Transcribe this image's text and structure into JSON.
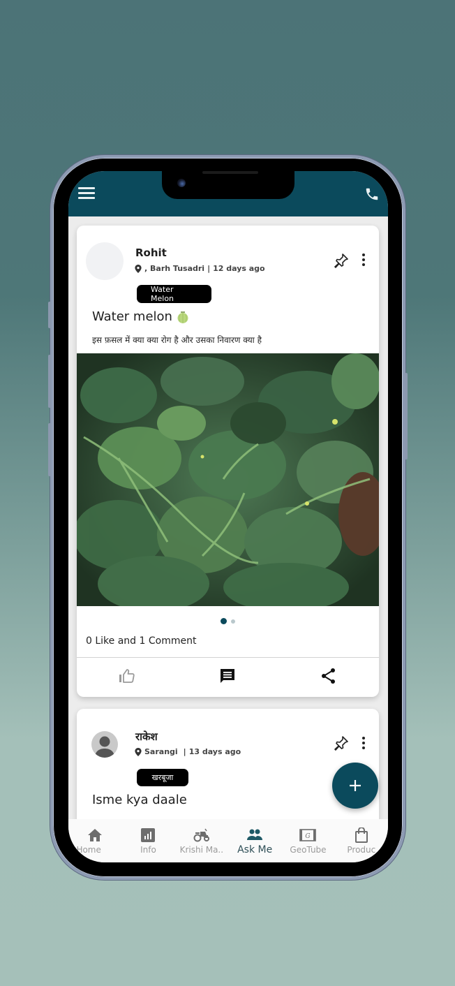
{
  "appbar": {
    "menu_icon": "hamburger-menu-icon",
    "call_icon": "phone-call-icon",
    "color": "#0b4a5c"
  },
  "posts": [
    {
      "author": "Rohit",
      "location": ", Barh Tusadri",
      "separator": "|",
      "time_ago": "12 days ago",
      "crop_tag": "Water Melon",
      "title": "Water melon",
      "title_emoji": "melon-icon",
      "body": "इस फ़सल में क्या क्या रोग है और उसका निवारण क्या है",
      "has_image": true,
      "image_description": "Watermelon plant leaves",
      "carousel": {
        "total": 2,
        "active": 1
      },
      "stats": "0 Like and 1 Comment",
      "actions": [
        "like",
        "comment",
        "share"
      ]
    },
    {
      "author": "राकेश",
      "location": "Sarangi",
      "separator": "|",
      "time_ago": "13 days ago",
      "crop_tag": "खरबूजा",
      "title": "Isme kya daale"
    }
  ],
  "fab": {
    "icon": "plus-icon",
    "label": "Add post"
  },
  "bottom_nav": {
    "active_index": 3,
    "items": [
      {
        "label": "Home",
        "icon": "home-icon"
      },
      {
        "label": "Info",
        "icon": "chart-icon"
      },
      {
        "label": "Krishi Ma..",
        "icon": "tractor-icon"
      },
      {
        "label": "Ask Me",
        "icon": "people-icon"
      },
      {
        "label": "GeoTube",
        "icon": "film-icon"
      },
      {
        "label": "Produc",
        "icon": "shopping-bag-icon"
      }
    ]
  },
  "colors": {
    "primary": "#0b4a5c",
    "tag_bg": "#000000",
    "inactive_nav": "#9a9a9a"
  }
}
